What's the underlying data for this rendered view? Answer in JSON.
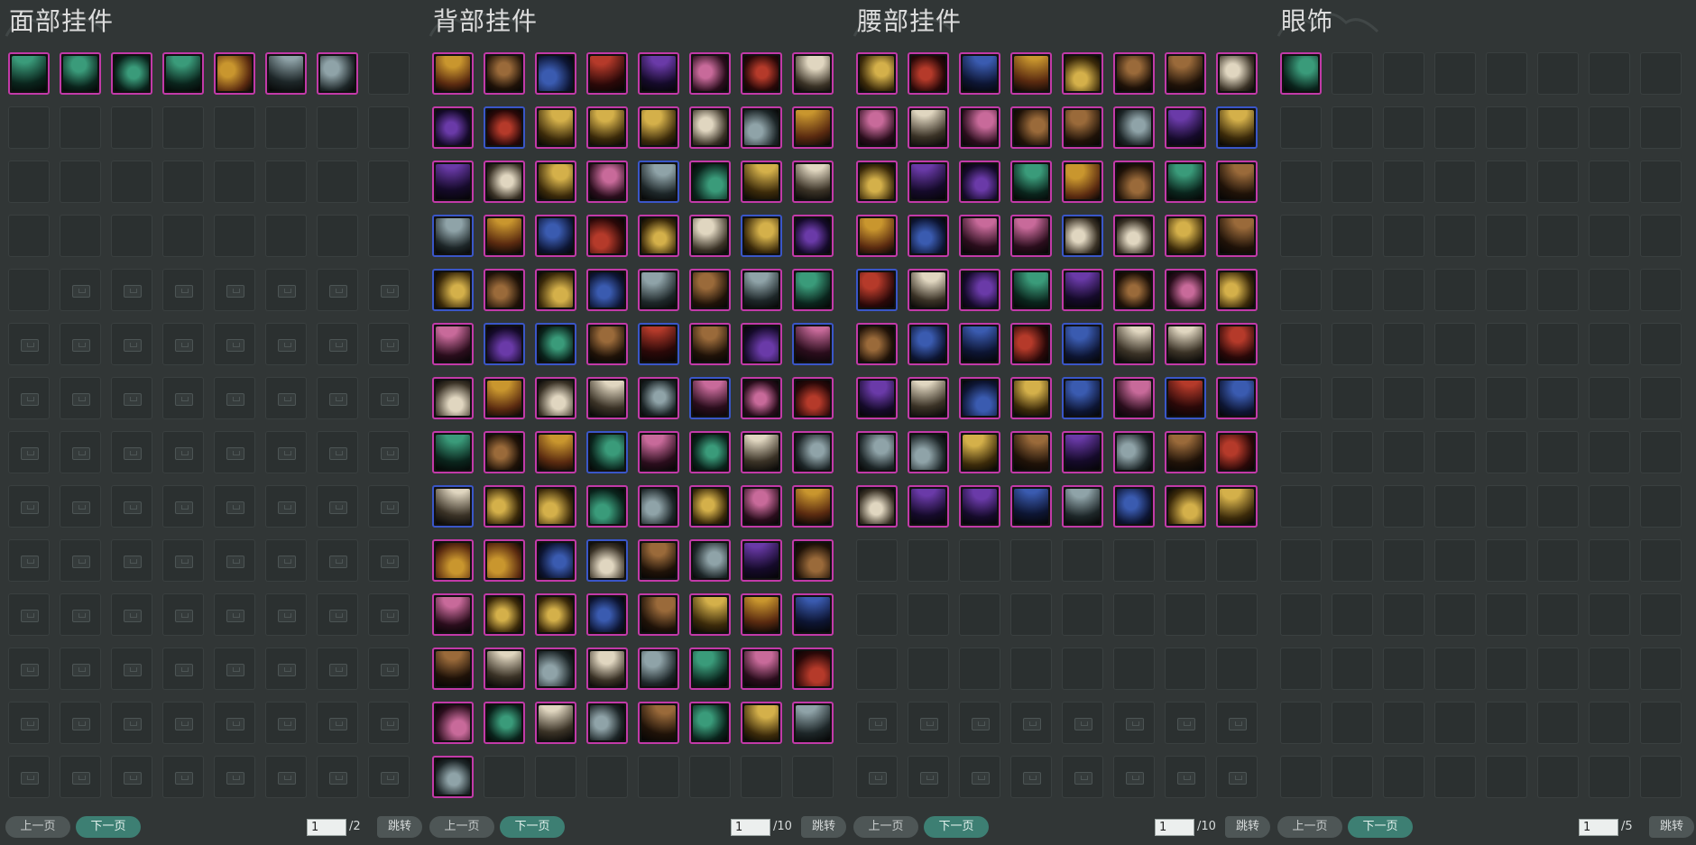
{
  "panels": [
    {
      "title": "面部挂件",
      "icons": [
        "dragon-mask",
        "blue-hat",
        "ghost-mask",
        "silver-shield-mask",
        "mustache",
        "gold-mask",
        "white-oni-mask"
      ],
      "locked_from": 33,
      "page": {
        "prev": "上一页",
        "next": "下一页",
        "current": "1",
        "total": "/2",
        "jump": "跳转"
      }
    },
    {
      "title": "背部挂件",
      "icons": [
        "lantern-fan",
        "white-rack",
        "crane",
        "sword-pair",
        "gold-cage",
        "silver-orb",
        "dark-sword",
        "bone-sword",
        "purple-wings",
        "gold-wheel",
        "gold-disc",
        "lantern",
        "blossom-branch",
        "gold-sword",
        "gold-blade",
        "panda-box",
        "white-fan",
        "jade-spear",
        "red-parrot",
        "doll",
        "abacus",
        "dark-wheel",
        "red-drum",
        "red-robe",
        "fire-ring",
        "white-fan-2",
        "jade-staff",
        "orb-staff",
        "red-web",
        "wood-blade",
        "crossbow",
        "white-flower",
        "paper-fan",
        "scroll-book",
        "jade-gourd",
        "gold-staff",
        "pink-bear",
        "dark-shell",
        "blue-crossbow",
        "horse-toy",
        "red-blossom",
        "dark-staff",
        "silver-compass",
        "gold-arch",
        "blue-orb",
        "dragon-sword",
        "gold-shell",
        "purple-cat",
        "gold-spear",
        "blue-globe",
        "blue-moon",
        "silver-lantern",
        "blue-globe-2",
        "forest-box",
        "blue-drum",
        "dream-catcher",
        "flower-ring",
        "gold-tassel",
        "sun-disc",
        "white-pavilion",
        "jade-pendant",
        "pipa",
        "blue-box",
        "gold-clock",
        "quiver",
        "blue-book",
        "blue-bird",
        "gold-flame",
        "gold-wheel-2",
        "gold-lance",
        "silver-book",
        "blue-swirl",
        "gold-hairpin",
        "bells",
        "white-garland",
        "gold-key",
        "monkey",
        "peach",
        "straw-hat",
        "white-bird",
        "fire-bowl",
        "red-bow",
        "white-lute",
        "shell-staff",
        "silver-mirror",
        "pink-shovel",
        "blue-string",
        "gold-fish",
        "pink-tassel",
        "white-wings",
        "bamboo-bundle",
        "rose-cage",
        "gold-lance-2",
        "silver-shard",
        "lamp-staff",
        "silver-ring",
        "crescent",
        "sun-wheel",
        "pearl-string",
        "blue-crystal",
        "red-shrine",
        "wood-hammer",
        "red-clock",
        "blue-clock",
        "silver-key"
      ],
      "locked_from": 999,
      "page": {
        "prev": "上一页",
        "next": "下一页",
        "current": "1",
        "total": "/10",
        "jump": "跳转"
      }
    },
    {
      "title": "腰部挂件",
      "icons": [
        "gold-gourd",
        "white-flowers",
        "zebra-toy",
        "pink-peony",
        "white-lily",
        "jade-snake",
        "red-sword",
        "gold-sword",
        "dark-flute",
        "chime-rack",
        "pale-flowers",
        "jade-dagger",
        "gold-lantern",
        "gold-clock",
        "silver-sword",
        "gold-horn",
        "blue-doll",
        "horn-crest",
        "dark-wings",
        "gold-vase",
        "gold-bell",
        "silver-disc",
        "purple-kitten",
        "gold-gourd-2",
        "peach-plate",
        "gold-staff",
        "red-target",
        "gold-bundle",
        "blue-vase",
        "dark-chain",
        "dark-net",
        "silver-charm",
        "gold-scroll",
        "red-knot",
        "jade-shell",
        "fire-pouch",
        "silver-ghost",
        "gold-bells",
        "green-horse",
        "blue-book",
        "gold-tassel",
        "green-sword",
        "green-dragon",
        "orange-wing",
        "gold-deer",
        "silver-ribbon",
        "blue-sword",
        "gold-bird",
        "pink-rabbit",
        "wood-flute",
        "jade-drops",
        "silver-rattle",
        "white-gourd",
        "gold-ring",
        "red-tassel",
        "dark-lamp",
        "pink-flowers",
        "bamboo-bundle",
        "silver-tassel",
        "blue-sword-2",
        "blue-dagger",
        "jade-flute",
        "red-knot-2",
        "gold-charm",
        "white-bead",
        "blue-plaque",
        "red-scroll",
        "gold-fish",
        "gold-bell-2",
        "dark-tassel",
        "red-crystal",
        "blue-crest"
      ],
      "locked_from": 96,
      "page": {
        "prev": "上一页",
        "next": "下一页",
        "current": "1",
        "total": "/10",
        "jump": "跳转"
      }
    },
    {
      "title": "眼饰",
      "icons": [
        "gold-monocle"
      ],
      "locked_from": 999,
      "page": {
        "prev": "上一页",
        "next": "下一页",
        "current": "1",
        "total": "/5",
        "jump": "跳转"
      }
    }
  ],
  "colors": {
    "background": "#313636",
    "item_border": "#c23aa8",
    "next_button": "#3d7f73"
  }
}
